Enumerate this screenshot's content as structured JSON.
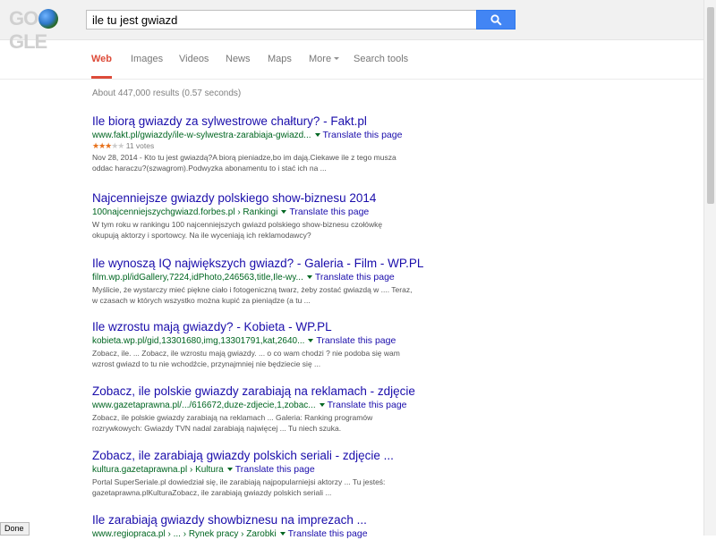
{
  "header": {
    "logo_text": "GOOGLE",
    "search_value": "ile tu jest gwiazd"
  },
  "nav": {
    "tabs": [
      "Web",
      "Images",
      "Videos",
      "News",
      "Maps",
      "More",
      "Search tools"
    ],
    "active": "Web"
  },
  "stats": "About 447,000 results (0.57 seconds)",
  "results": [
    {
      "title": "Ile biorą gwiazdy za sylwestrowe chałtury? - Fakt.pl",
      "url": "www.fakt.pl/gwiazdy/ile-w-sylwestra-zarabiaja-gwiazd...",
      "translate": "Translate this page",
      "rating": {
        "stars": 3,
        "max": 5,
        "votes": "11 votes"
      },
      "snippet": [
        "Nov 28, 2014 - Kto tu jest gwiazdą?A biorą pieniadze,bo im dają.Ciekawe ile z tego musza",
        "oddac haraczu?(szwagrom).Podwyzka abonamentu to i stać ich na ..."
      ]
    },
    {
      "title": "Najcenniejsze gwiazdy polskiego show-biznesu 2014",
      "url": "100najcenniejszychgwiazd.forbes.pl › Rankingi",
      "translate": "Translate this page",
      "snippet": [
        "W tym roku w rankingu 100 najcenniejszych gwiazd polskiego show-biznesu czołówkę",
        "okupują aktorzy i sportowcy. Na ile wyceniają ich reklamodawcy?"
      ]
    },
    {
      "title": "Ile wynoszą IQ największych gwiazd? - Galeria - Film - WP.PL",
      "url": "film.wp.pl/idGallery,7224,idPhoto,246563,title,Ile-wy...",
      "translate": "Translate this page",
      "snippet": [
        "Myślicie, że wystarczy mieć piękne ciało i fotogeniczną twarz, żeby zostać gwiazdą w .... Teraz,",
        "w czasach w których wszystko można kupić za pieniądze (a tu ..."
      ]
    },
    {
      "title": "Ile wzrostu mają gwiazdy? - Kobieta - WP.PL",
      "url": "kobieta.wp.pl/gid,13301680,img,13301791,kat,2640...",
      "translate": "Translate this page",
      "snippet": [
        "Zobacz, ile. ... Zobacz, ile wzrostu mają gwiazdy. ... o co wam chodzi ? nie podoba się wam",
        "wzrost gwiazd to tu nie wchodźcie, przynajmniej nie będziecie się ..."
      ]
    },
    {
      "title": "Zobacz, ile polskie gwiazdy zarabiają na reklamach - zdjęcie",
      "url": "www.gazetaprawna.pl/.../616672,duze-zdjecie,1,zobac...",
      "translate": "Translate this page",
      "snippet": [
        "Zobacz, ile polskie gwiazdy zarabiają na reklamach ... Galeria: Ranking programów",
        "rozrywkowych: Gwiazdy TVN nadal zarabiają najwięcej ... Tu niech szuka."
      ]
    },
    {
      "title": "Zobacz, ile zarabiają gwiazdy polskich seriali - zdjęcie ...",
      "url": "kultura.gazetaprawna.pl › Kultura",
      "translate": "Translate this page",
      "snippet": [
        "Portal SuperSeriale.pl dowiedział się, ile zarabiają najpopularniejsi aktorzy ... Tu jesteś:",
        "gazetaprawna.plKulturaZobacz, ile zarabiają gwiazdy polskich seriali ..."
      ]
    },
    {
      "title": "Ile zarabiają gwiazdy showbiznesu na imprezach ...",
      "url": "www.regiopraca.pl › ... › Rynek pracy › Zarobki",
      "translate": "Translate this page",
      "snippet": []
    }
  ],
  "statusbar": "Done"
}
